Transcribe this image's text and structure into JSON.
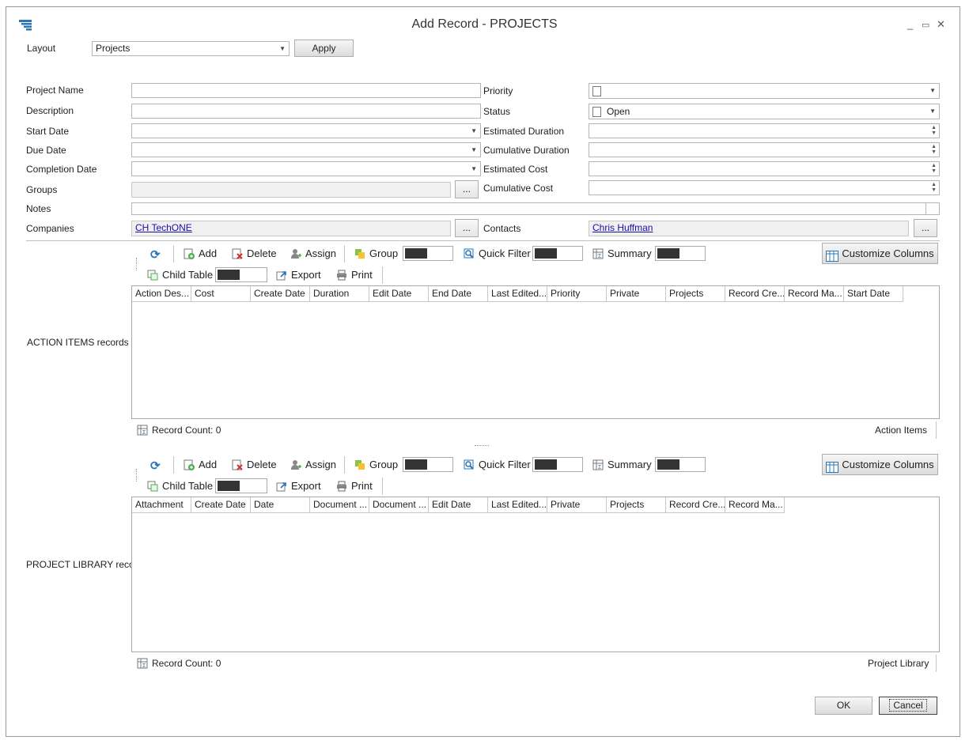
{
  "window": {
    "title": "Add Record - PROJECTS",
    "controls": [
      "_",
      "▭",
      "✕"
    ]
  },
  "layout": {
    "label": "Layout",
    "value": "Projects",
    "apply_label": "Apply"
  },
  "form": {
    "project_name_label": "Project Name",
    "description_label": "Description",
    "start_date_label": "Start Date",
    "due_date_label": "Due Date",
    "completion_date_label": "Completion Date",
    "groups_label": "Groups",
    "notes_label": "Notes",
    "companies_label": "Companies",
    "companies_value": "CH TechONE",
    "priority_label": "Priority",
    "status_label": "Status",
    "status_value": "Open",
    "estimated_duration_label": "Estimated Duration",
    "cumulative_duration_label": "Cumulative Duration",
    "estimated_cost_label": "Estimated Cost",
    "cumulative_cost_label": "Cumulative Cost",
    "contacts_label": "Contacts",
    "contacts_value": "Chris Huffman",
    "ellipsis": "..."
  },
  "toolbar": {
    "add": "Add",
    "delete": "Delete",
    "assign": "Assign",
    "group": "Group",
    "quick_filter": "Quick Filter",
    "summary": "Summary",
    "customize_columns": "Customize Columns",
    "child_table": "Child Table",
    "export": "Export",
    "print": "Print"
  },
  "action_items": {
    "section_label": "ACTION ITEMS records",
    "columns": [
      "Action Des...",
      "Cost",
      "Create Date",
      "Duration",
      "Edit Date",
      "End Date",
      "Last Edited...",
      "Priority",
      "Private",
      "Projects",
      "Record Cre...",
      "Record Ma...",
      "Start Date"
    ],
    "record_count": "Record Count: 0",
    "footer_name": "Action Items"
  },
  "project_library": {
    "section_label": "PROJECT LIBRARY records",
    "columns": [
      "Attachment",
      "Create Date",
      "Date",
      "Document ...",
      "Document ...",
      "Edit Date",
      "Last Edited...",
      "Private",
      "Projects",
      "Record Cre...",
      "Record Ma..."
    ],
    "record_count": "Record Count: 0",
    "footer_name": "Project Library"
  },
  "footer": {
    "ok": "OK",
    "cancel": "Cancel"
  }
}
